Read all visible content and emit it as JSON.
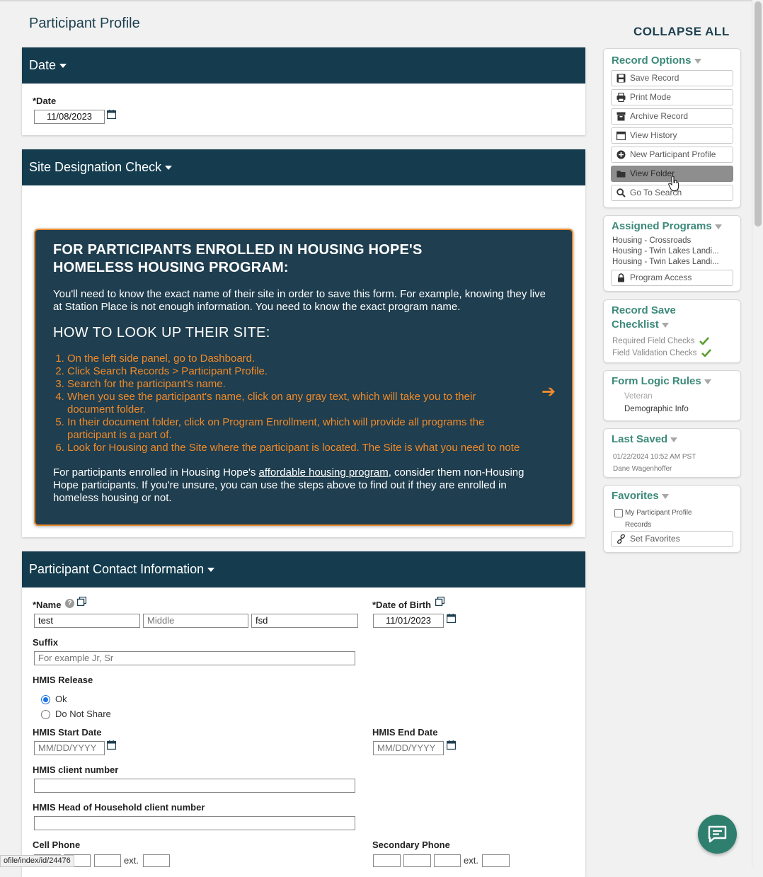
{
  "page_title": "Participant Profile",
  "sections": {
    "date": {
      "header": "Date",
      "date_label": "*Date",
      "date_value": "11/08/2023"
    },
    "site": {
      "header": "Site Designation Check",
      "info": {
        "title": "FOR PARTICIPANTS ENROLLED IN HOUSING HOPE'S HOMELESS HOUSING PROGRAM:",
        "intro": "You'll need to know the exact name of their site in order to save this form. For example, knowing they live at Station Place is not enough information. You need to know the exact program name.",
        "howto_title": "HOW TO LOOK UP THEIR SITE:",
        "steps": [
          "On the left side panel, go to Dashboard.",
          "Click Search Records > Participant Profile.",
          "Search for the participant's name.",
          "When you see the participant's name, click on any gray text, which will take you to their document folder.",
          "In their document folder, click on Program Enrollment, which will provide all programs the participant is a part of.",
          "Look for Housing and the Site where the participant is located. The Site is what you need to note"
        ],
        "arrow": "➔",
        "footer_pre": "For participants enrolled in Housing Hope's ",
        "footer_link": "affordable housing program",
        "footer_post": ", consider them non-Housing Hope participants. If you're unsure, you can use the steps above to find out if they are enrolled in homeless housing or not."
      }
    },
    "contact": {
      "header": "Participant Contact Information",
      "name_label": "*Name",
      "name_first": "test",
      "name_middle_placeholder": "Middle",
      "name_last": "fsd",
      "dob_label": "*Date of Birth",
      "dob_value": "11/01/2023",
      "suffix_label": "Suffix",
      "suffix_placeholder": "For example Jr, Sr",
      "hmis_release_label": "HMIS Release",
      "hmis_release_options": [
        "Ok",
        "Do Not Share"
      ],
      "hmis_release_selected": "Ok",
      "hmis_start_label": "HMIS Start Date",
      "hmis_end_label": "HMIS End Date",
      "date_placeholder": "MM/DD/YYYY",
      "hmis_client_label": "HMIS client number",
      "hmis_head_label": "HMIS Head of Household client number",
      "cell_phone_label": "Cell Phone",
      "secondary_phone_label": "Secondary Phone",
      "ext_label": "ext."
    }
  },
  "sidebar": {
    "collapse_all": "COLLAPSE ALL",
    "record_options": {
      "title": "Record Options",
      "buttons": [
        "Save Record",
        "Print Mode",
        "Archive Record",
        "View History",
        "New Participant Profile",
        "View Folder",
        "Go To Search"
      ],
      "active": "View Folder"
    },
    "assigned_programs": {
      "title": "Assigned Programs",
      "items": [
        "Housing - Crossroads",
        "Housing - Twin Lakes Landi...",
        "Housing - Twin Lakes Landi..."
      ],
      "button": "Program Access"
    },
    "checklist": {
      "title_line1": "Record Save",
      "title_line2": "Checklist",
      "items": [
        "Required Field Checks",
        "Field Validation Checks"
      ]
    },
    "form_logic": {
      "title": "Form Logic Rules",
      "items": [
        "Veteran",
        "Demographic Info"
      ]
    },
    "last_saved": {
      "title": "Last Saved",
      "timestamp": "01/22/2024 10:52 AM PST",
      "user": "Dane Wagenhoffer"
    },
    "favorites": {
      "title": "Favorites",
      "checkbox_line1": "My Participant Profile",
      "checkbox_line2": "Records",
      "button": "Set Favorites"
    }
  },
  "status_url": "ofile/index/id/24476",
  "colors": {
    "header_bg": "#143c4e",
    "info_bg": "#1f3e4f",
    "accent_orange": "#f08a2a",
    "panel_title": "#3c8a7a",
    "check_green": "#5a9e2f",
    "chat_bg": "#2e7f6e"
  }
}
